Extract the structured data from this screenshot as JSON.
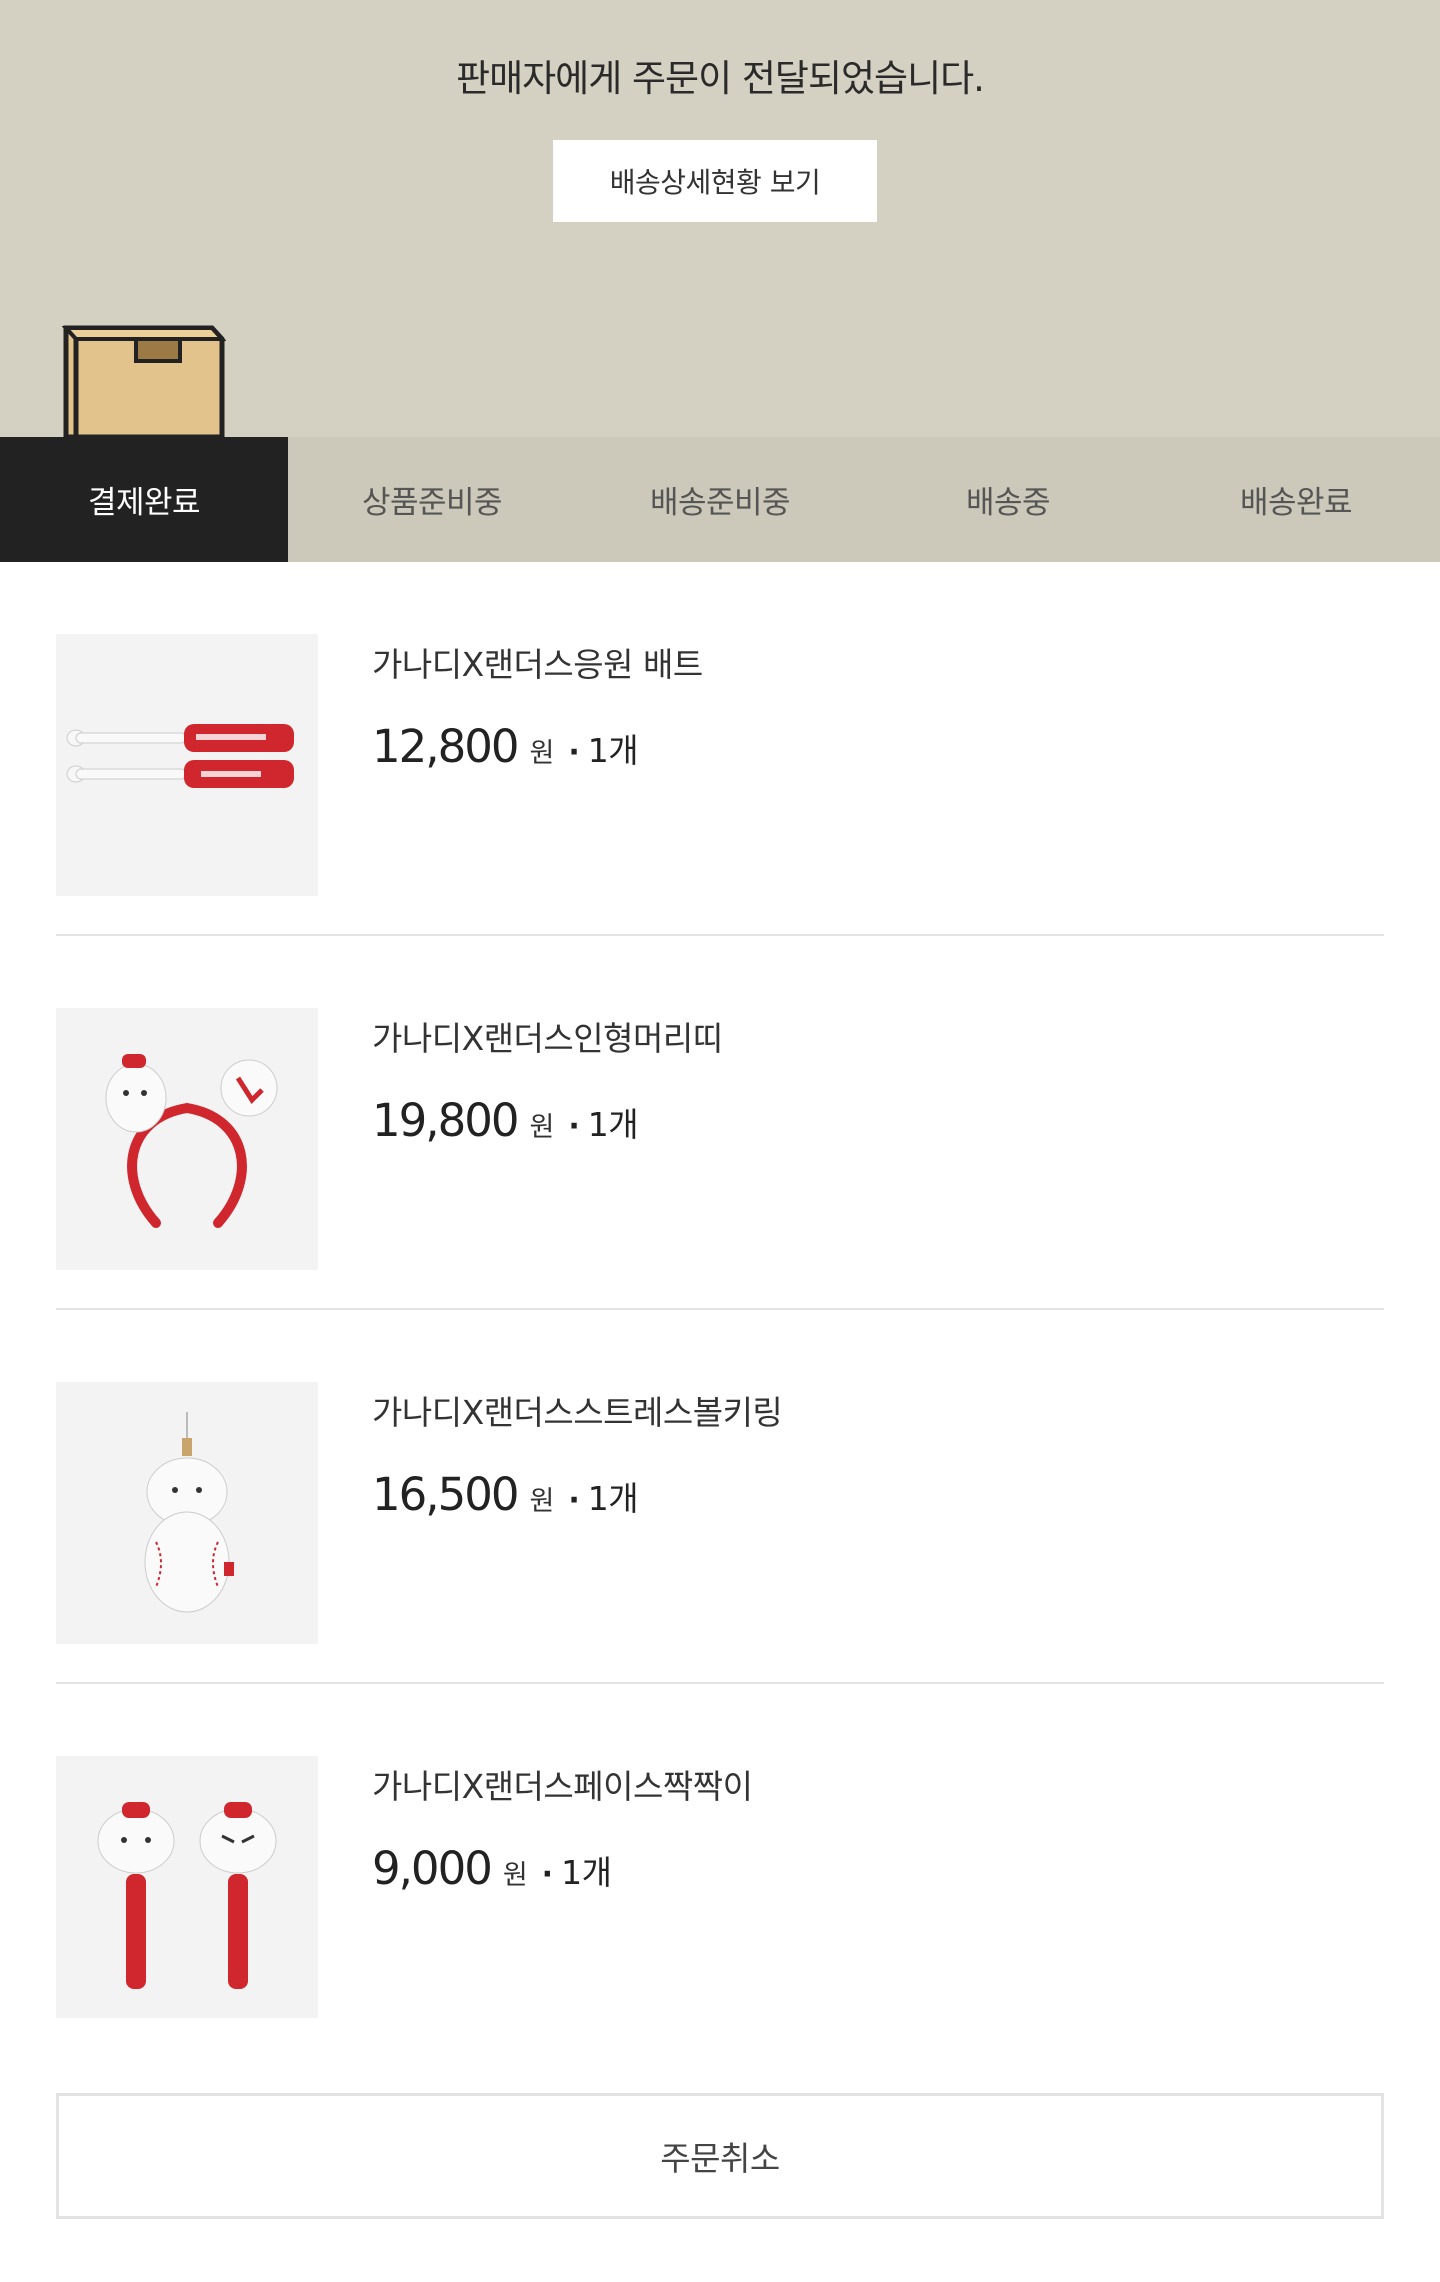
{
  "hero": {
    "message": "판매자에게 주문이 전달되었습니다.",
    "detail_button": "배송상세현황 보기",
    "box_icon": "delivery-box-icon"
  },
  "steps": [
    {
      "label": "결제완료",
      "active": true
    },
    {
      "label": "상품준비중",
      "active": false
    },
    {
      "label": "배송준비중",
      "active": false
    },
    {
      "label": "배송중",
      "active": false
    },
    {
      "label": "배송완료",
      "active": false
    }
  ],
  "items": [
    {
      "name": "가나디X랜더스응원 배트",
      "price": "12,800",
      "currency": "원",
      "separator": "·",
      "quantity": "1개",
      "image_icon": "cheering-bat-image"
    },
    {
      "name": "가나디X랜더스인형머리띠",
      "price": "19,800",
      "currency": "원",
      "separator": "·",
      "quantity": "1개",
      "image_icon": "doll-headband-image"
    },
    {
      "name": "가나디X랜더스스트레스볼키링",
      "price": "16,500",
      "currency": "원",
      "separator": "·",
      "quantity": "1개",
      "image_icon": "stress-ball-keyring-image"
    },
    {
      "name": "가나디X랜더스페이스짝짝이",
      "price": "9,000",
      "currency": "원",
      "separator": "·",
      "quantity": "1개",
      "image_icon": "face-clapper-image"
    }
  ],
  "cancel_button": "주문취소",
  "colors": {
    "hero_bg": "#d4d0c2",
    "steps_bg": "#ccc9ba",
    "active_step": "#222222",
    "accent_red": "#d32f2f"
  }
}
